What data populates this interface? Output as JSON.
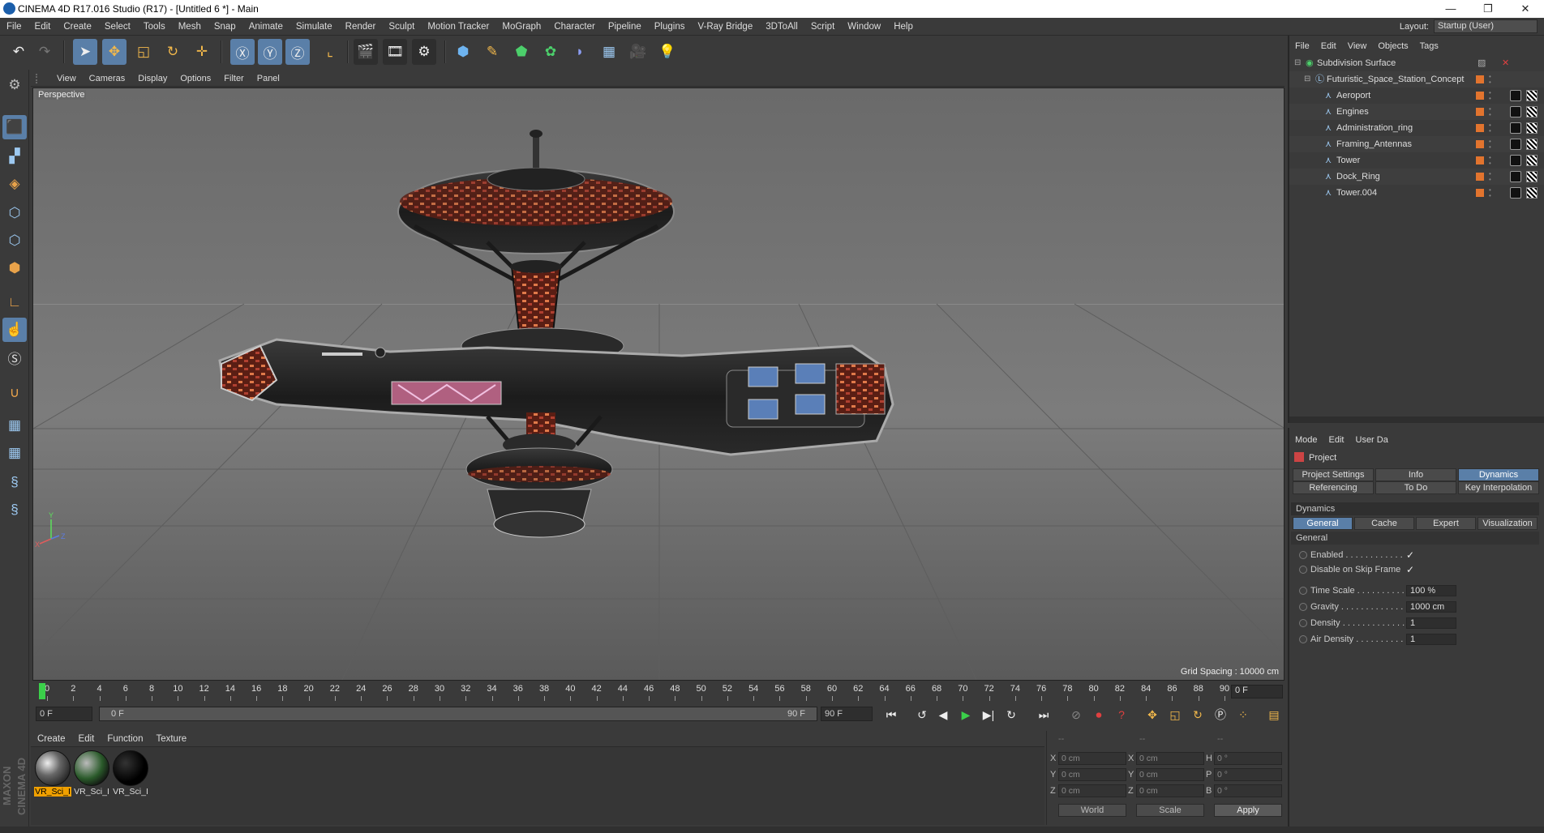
{
  "window": {
    "title": "CINEMA 4D R17.016 Studio (R17) - [Untitled 6 *] - Main",
    "controls": [
      "—",
      "❐",
      "✕"
    ]
  },
  "menubar": [
    "File",
    "Edit",
    "Create",
    "Select",
    "Tools",
    "Mesh",
    "Snap",
    "Animate",
    "Simulate",
    "Render",
    "Sculpt",
    "Motion Tracker",
    "MoGraph",
    "Character",
    "Pipeline",
    "Plugins",
    "V-Ray Bridge",
    "3DToAll",
    "Script",
    "Window",
    "Help"
  ],
  "layout": {
    "label": "Layout:",
    "value": "Startup (User)"
  },
  "viewport": {
    "menu": [
      "View",
      "Cameras",
      "Display",
      "Options",
      "Filter",
      "Panel"
    ],
    "label": "Perspective",
    "grid_spacing": "Grid Spacing : 10000 cm",
    "axis_labels": [
      "Y",
      "X",
      "Z"
    ]
  },
  "timeline": {
    "ticks": [
      "0",
      "2",
      "4",
      "6",
      "8",
      "10",
      "12",
      "14",
      "16",
      "18",
      "20",
      "22",
      "24",
      "26",
      "28",
      "30",
      "32",
      "34",
      "36",
      "38",
      "40",
      "42",
      "44",
      "46",
      "48",
      "50",
      "52",
      "54",
      "56",
      "58",
      "60",
      "62",
      "64",
      "66",
      "68",
      "70",
      "72",
      "74",
      "76",
      "78",
      "80",
      "82",
      "84",
      "86",
      "88",
      "90"
    ],
    "current_frame": "0 F",
    "start_field": "0 F",
    "range_start": "0 F",
    "range_end": "90 F",
    "end_field": "90 F"
  },
  "materials": {
    "menu": [
      "Create",
      "Edit",
      "Function",
      "Texture"
    ],
    "items": [
      {
        "label": "VR_Sci_I",
        "selected": true
      },
      {
        "label": "VR_Sci_I",
        "selected": false
      },
      {
        "label": "VR_Sci_I",
        "selected": false
      }
    ]
  },
  "coords": {
    "headers": [
      "--",
      "--",
      "--"
    ],
    "rows": [
      {
        "a": "X",
        "av": "0 cm",
        "b": "X",
        "bv": "0 cm",
        "c": "H",
        "cv": "0 °"
      },
      {
        "a": "Y",
        "av": "0 cm",
        "b": "Y",
        "bv": "0 cm",
        "c": "P",
        "cv": "0 °"
      },
      {
        "a": "Z",
        "av": "0 cm",
        "b": "Z",
        "bv": "0 cm",
        "c": "B",
        "cv": "0 °"
      }
    ],
    "world": "World",
    "scale": "Scale",
    "apply": "Apply"
  },
  "brand": "MAXON CINEMA 4D",
  "objects": {
    "menu": [
      "File",
      "Edit",
      "View",
      "Objects",
      "Tags"
    ],
    "tree": [
      {
        "name": "Subdivision Surface",
        "indent": 0
      },
      {
        "name": "Futuristic_Space_Station_Concept",
        "indent": 1
      },
      {
        "name": "Aeroport",
        "indent": 2
      },
      {
        "name": "Engines",
        "indent": 2
      },
      {
        "name": "Administration_ring",
        "indent": 2
      },
      {
        "name": "Framing_Antennas",
        "indent": 2
      },
      {
        "name": "Tower",
        "indent": 2
      },
      {
        "name": "Dock_Ring",
        "indent": 2
      },
      {
        "name": "Tower.004",
        "indent": 2
      }
    ]
  },
  "attributes": {
    "menu": [
      "Mode",
      "Edit",
      "User Da"
    ],
    "object": "Project",
    "tabs_row1": [
      {
        "label": "Project Settings",
        "on": false
      },
      {
        "label": "Info",
        "on": false
      },
      {
        "label": "Dynamics",
        "on": true
      }
    ],
    "tabs_row2": [
      {
        "label": "Referencing",
        "on": false
      },
      {
        "label": "To Do",
        "on": false
      },
      {
        "label": "Key Interpolation",
        "on": false
      }
    ],
    "section": "Dynamics",
    "subtabs": [
      {
        "label": "General",
        "on": true
      },
      {
        "label": "Cache",
        "on": false
      },
      {
        "label": "Expert",
        "on": false
      },
      {
        "label": "Visualization",
        "on": false
      }
    ],
    "group": "General",
    "props": [
      {
        "label": "Enabled . . . . . . . . . . . .",
        "check": "✓"
      },
      {
        "label": "Disable on Skip Frame",
        "check": "✓"
      },
      {
        "label": "Time Scale . . . . . . . . . .",
        "value": "100 %"
      },
      {
        "label": "Gravity . . . . . . . . . . . . .",
        "value": "1000 cm"
      },
      {
        "label": "Density . . . . . . . . . . . . .",
        "value": "1"
      },
      {
        "label": "Air Density . . . . . . . . . .",
        "value": "1"
      }
    ]
  },
  "colors": {
    "accent": "#5a7fa8",
    "orange": "#e2742e",
    "panel": "#3a3a3a"
  }
}
